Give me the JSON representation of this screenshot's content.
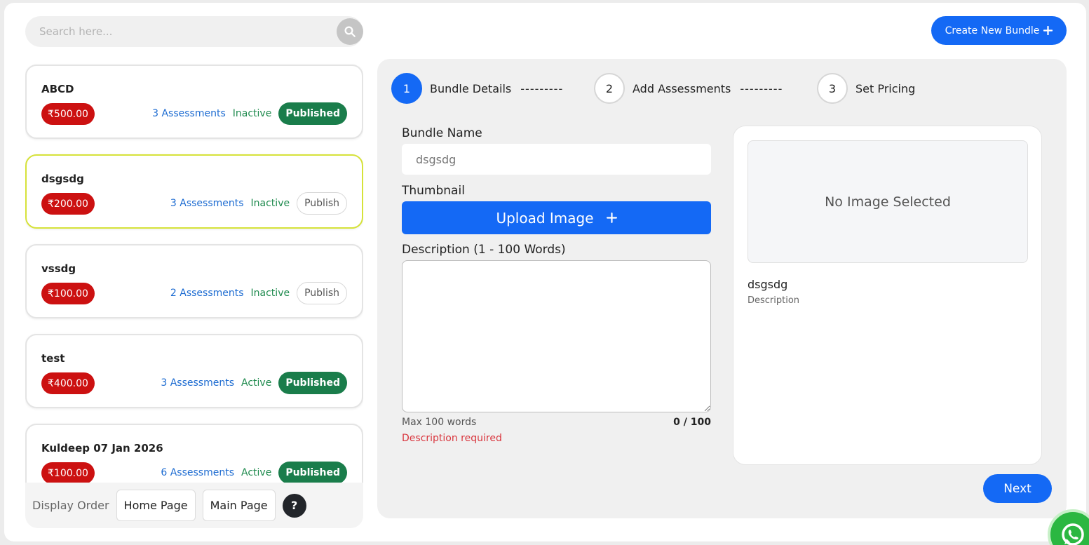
{
  "search": {
    "placeholder": "Search here..."
  },
  "header": {
    "create_label": "Create New Bundle"
  },
  "bundles": [
    {
      "title": "ABCD",
      "price": "₹500.00",
      "assessments": "3 Assessments",
      "status": "Inactive",
      "publish": "Published",
      "published": true,
      "selected": false
    },
    {
      "title": "dsgsdg",
      "price": "₹200.00",
      "assessments": "3 Assessments",
      "status": "Inactive",
      "publish": "Publish",
      "published": false,
      "selected": true
    },
    {
      "title": "vssdg",
      "price": "₹100.00",
      "assessments": "2 Assessments",
      "status": "Inactive",
      "publish": "Publish",
      "published": false,
      "selected": false
    },
    {
      "title": "test",
      "price": "₹400.00",
      "assessments": "3 Assessments",
      "status": "Active",
      "publish": "Published",
      "published": true,
      "selected": false
    },
    {
      "title": "Kuldeep 07 Jan 2026",
      "price": "₹100.00",
      "assessments": "6 Assessments",
      "status": "Active",
      "publish": "Published",
      "published": true,
      "selected": false
    }
  ],
  "display_order": {
    "label": "Display Order",
    "home": "Home Page",
    "main": "Main Page",
    "help": "?"
  },
  "steps": [
    {
      "num": "1",
      "label": "Bundle Details",
      "active": true
    },
    {
      "num": "2",
      "label": "Add Assessments",
      "active": false
    },
    {
      "num": "3",
      "label": "Set Pricing",
      "active": false
    }
  ],
  "step_dash": "---------",
  "form": {
    "name_label": "Bundle Name",
    "name_value": "dsgsdg",
    "thumb_label": "Thumbnail",
    "upload_label": "Upload Image",
    "desc_label": "Description (1 - 100 Words)",
    "desc_value": "",
    "hint": "Max 100 words",
    "count": "0 / 100",
    "error": "Description required"
  },
  "preview": {
    "no_image": "No Image Selected",
    "title": "dsgsdg",
    "description": "Description"
  },
  "next_label": "Next",
  "colors": {
    "primary": "#1469f5",
    "price": "#cc1111",
    "published": "#1a7d4b",
    "selected_border": "#d6e23a",
    "error": "#d9363e"
  }
}
